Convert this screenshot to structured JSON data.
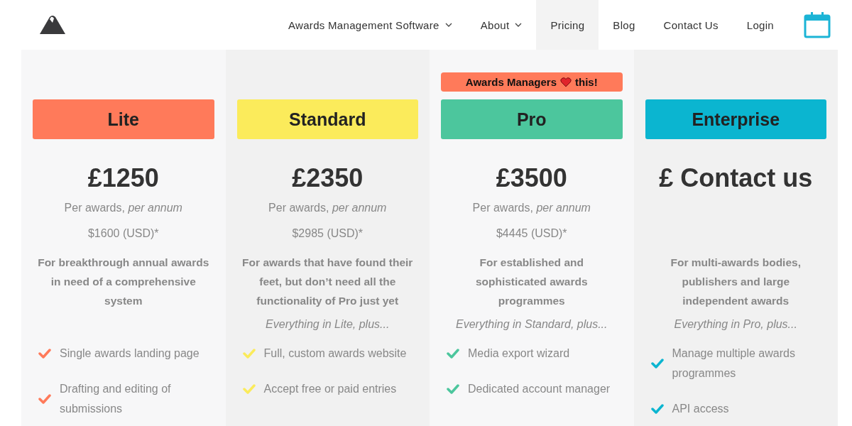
{
  "nav": {
    "items": [
      {
        "label": "Awards Management Software",
        "dropdown": true,
        "selected": false
      },
      {
        "label": "About",
        "dropdown": true,
        "selected": false
      },
      {
        "label": "Pricing",
        "dropdown": false,
        "selected": true
      },
      {
        "label": "Blog",
        "dropdown": false,
        "selected": false
      },
      {
        "label": "Contact Us",
        "dropdown": false,
        "selected": false
      },
      {
        "label": "Login",
        "dropdown": false,
        "selected": false
      }
    ]
  },
  "plans": [
    {
      "name": "Lite",
      "color": "#ff7a5a",
      "price": "£1250",
      "per": "Per awards, *per annum*",
      "usd": "$1600 (USD)*",
      "description": "For breakthrough annual awards in need of a comprehensive system",
      "features": [
        "Single awards landing page",
        "Drafting and editing of submissions"
      ]
    },
    {
      "name": "Standard",
      "color": "#fbeb5b",
      "price": "£2350",
      "per": "Per awards, *per annum*",
      "usd": "$2985 (USD)*",
      "description": "For awards that have found their feet, but don’t need all the functionality of Pro just yet",
      "intro": "Everything in Lite, plus...",
      "features": [
        "Full, custom awards website",
        "Accept free or paid entries"
      ]
    },
    {
      "name": "Pro",
      "color": "#4cc69d",
      "badge": {
        "before": "Awards Managers",
        "after": "this!"
      },
      "price": "£3500",
      "per": "Per awards, *per annum*",
      "usd": "$4445 (USD)*",
      "description": "For established and sophisticated awards programmes",
      "intro": "Everything in Standard, plus...",
      "features": [
        "Media export wizard",
        "Dedicated account manager"
      ]
    },
    {
      "name": "Enterprise",
      "color": "#0bb5d0",
      "price": "£ Contact us",
      "description": "For multi-awards bodies, publishers and large independent awards",
      "intro": "Everything in Pro, plus...",
      "features": [
        "Manage multiple awards programmes",
        "API access"
      ]
    }
  ]
}
